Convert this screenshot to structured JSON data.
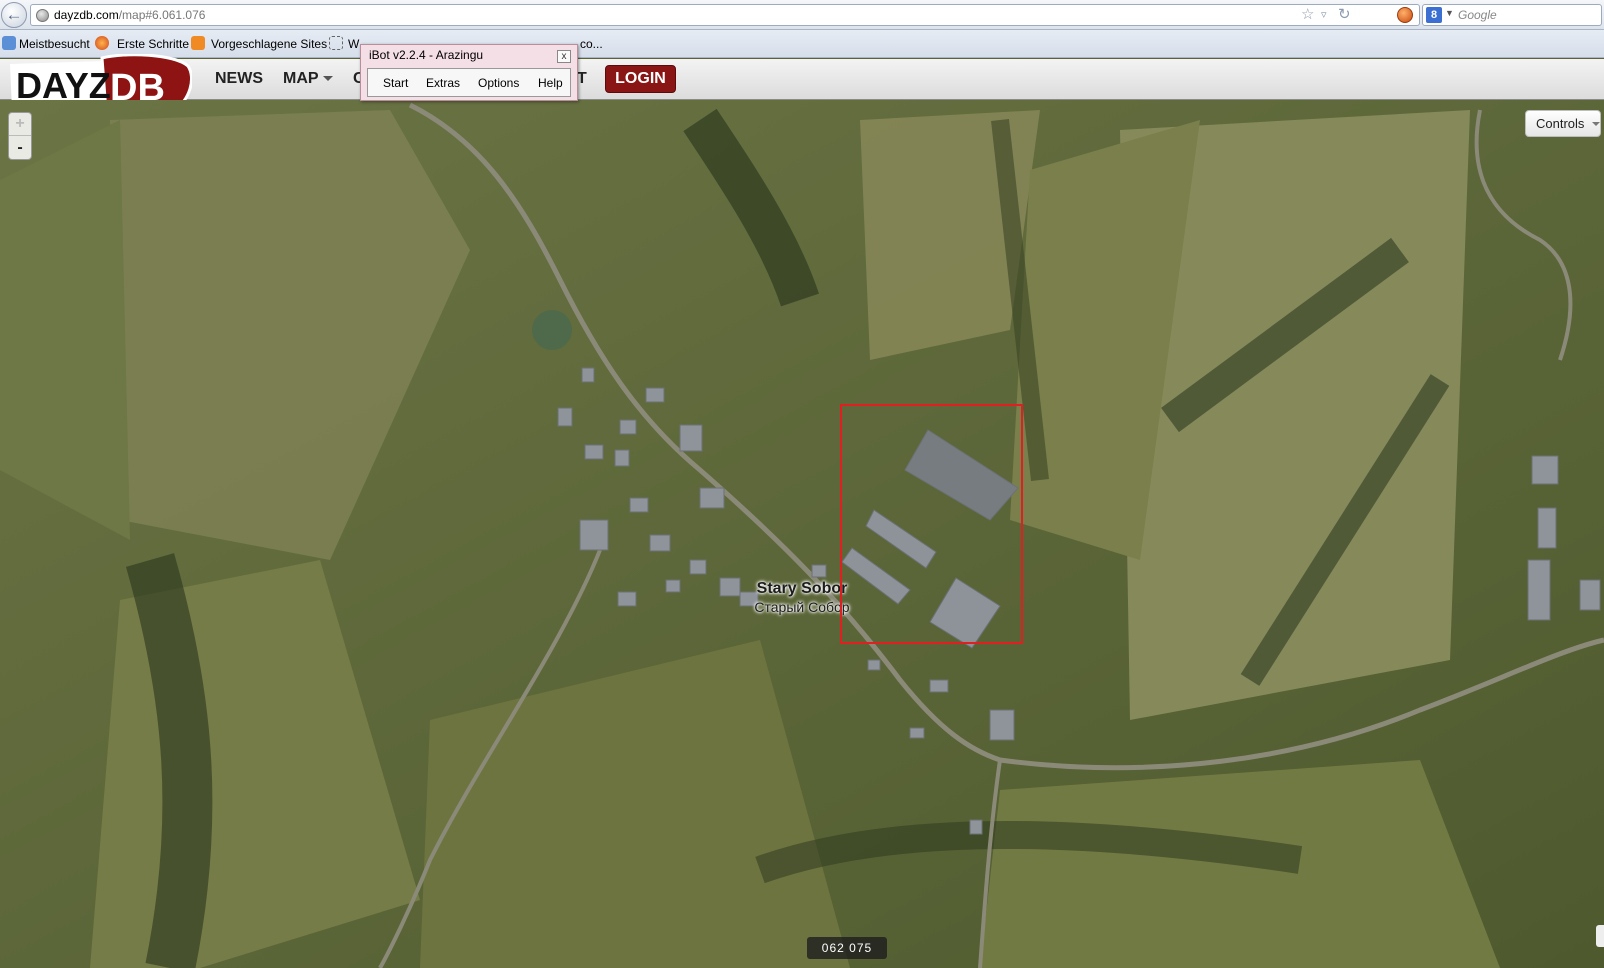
{
  "browser": {
    "url_domain": "dayzdb.com",
    "url_path": "/map#6.061.076",
    "search_placeholder": "Google",
    "search_engine_letter": "8",
    "bookmarks": [
      "Meistbesucht",
      "Erste Schritte",
      "Vorgeschlagene Sites",
      "W",
      "co..."
    ]
  },
  "site": {
    "logo_text_a": "DAYZ",
    "logo_text_b": "DB",
    "nav": {
      "news": "NEWS",
      "map": "MAP",
      "hidden_c": "C",
      "hidden_t": "T",
      "login": "LOGIN"
    }
  },
  "ibot": {
    "title": "iBot v2.2.4 - Arazingu",
    "close": "x",
    "menu": [
      "Start",
      "Extras",
      "Options",
      "Help"
    ]
  },
  "map": {
    "zoom_in": "+",
    "zoom_out": "-",
    "controls_label": "Controls",
    "town_name": "Stary Sobor",
    "town_name_ru": "Старый Собор",
    "coordinates": "062 075",
    "colors": {
      "highlight": "#e02020",
      "terrain": "#5a6236"
    }
  }
}
